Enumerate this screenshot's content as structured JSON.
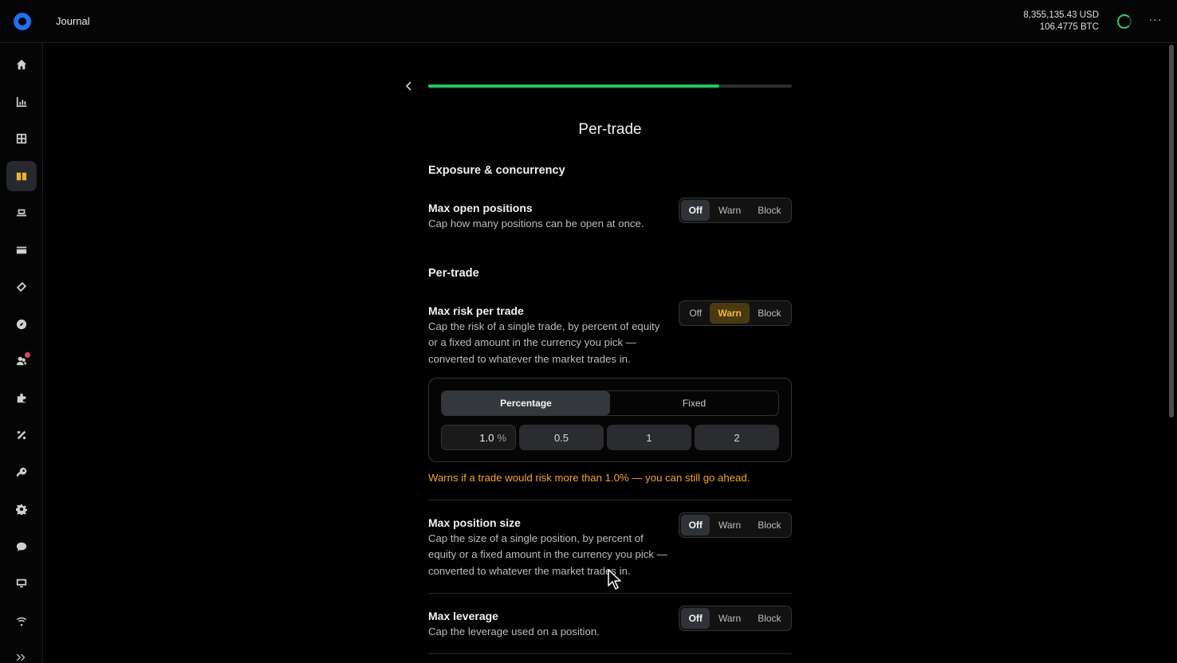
{
  "app": {
    "title": "Journal"
  },
  "balances": {
    "usd": "8,355,135.43 USD",
    "btc": "106.4775 BTC"
  },
  "header": {
    "more_label": "···"
  },
  "sidebar": {
    "items": [
      {
        "icon": "home-icon",
        "active": false
      },
      {
        "icon": "chart-icon",
        "active": false
      },
      {
        "icon": "grid-icon",
        "active": false
      },
      {
        "icon": "book-icon",
        "active": true
      },
      {
        "icon": "laptop-icon",
        "active": false
      },
      {
        "icon": "wallet-icon",
        "active": false
      },
      {
        "icon": "layers-icon",
        "active": false
      },
      {
        "icon": "compass-icon",
        "active": false
      },
      {
        "icon": "users-icon",
        "active": false,
        "badge": true
      },
      {
        "icon": "puzzle-icon",
        "active": false
      },
      {
        "icon": "percent-icon",
        "active": false
      },
      {
        "icon": "key-icon",
        "active": false
      },
      {
        "icon": "gear-icon",
        "active": false
      },
      {
        "icon": "chat-icon",
        "active": false
      },
      {
        "icon": "monitor-icon",
        "active": false
      },
      {
        "icon": "wifi-icon",
        "active": false
      },
      {
        "icon": "expand-icon",
        "active": false
      }
    ]
  },
  "wizard": {
    "progress": 0.8,
    "title": "Per-trade"
  },
  "sections": {
    "exposure": "Exposure & concurrency",
    "per_trade": "Per-trade"
  },
  "mode_options": [
    "Off",
    "Warn",
    "Block"
  ],
  "settings": {
    "max_open_positions": {
      "title": "Max open positions",
      "desc": "Cap how many positions can be open at once.",
      "mode": "Off"
    },
    "max_risk_per_trade": {
      "title": "Max risk per trade",
      "desc": "Cap the risk of a single trade, by percent of equity or a fixed amount in the currency you pick — converted to whatever the market trades in.",
      "mode": "Warn",
      "type_options": [
        "Percentage",
        "Fixed"
      ],
      "type_selected": "Percentage",
      "value": "1.0",
      "unit": "%",
      "presets": [
        "0.5",
        "1",
        "2"
      ],
      "note": "Warns if a trade would risk more than 1.0% — you can still go ahead."
    },
    "max_position_size": {
      "title": "Max position size",
      "desc": "Cap the size of a single position, by percent of equity or a fixed amount in the currency you pick — converted to whatever the market trades in.",
      "mode": "Off"
    },
    "max_leverage": {
      "title": "Max leverage",
      "desc": "Cap the leverage used on a position.",
      "mode": "Off"
    }
  },
  "colors": {
    "accent_progress": "#22c55e",
    "warn": "#f5a623",
    "active_nav": "#f0b429",
    "logo": "#1e6ff0"
  }
}
